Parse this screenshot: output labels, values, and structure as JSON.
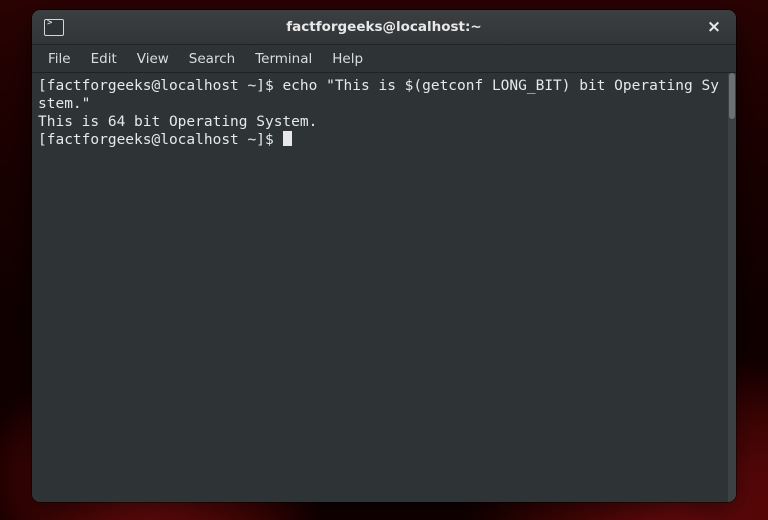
{
  "titlebar": {
    "title": "factforgeeks@localhost:~",
    "close_label": "×"
  },
  "menubar": {
    "items": [
      "File",
      "Edit",
      "View",
      "Search",
      "Terminal",
      "Help"
    ]
  },
  "terminal": {
    "lines": [
      {
        "prompt": "[factforgeeks@localhost ~]$ ",
        "command": "echo \"This is $(getconf LONG_BIT) bit Operating System.\""
      },
      {
        "output": "This is 64 bit Operating System."
      },
      {
        "prompt": "[factforgeeks@localhost ~]$ ",
        "command": "",
        "cursor": true
      }
    ]
  }
}
